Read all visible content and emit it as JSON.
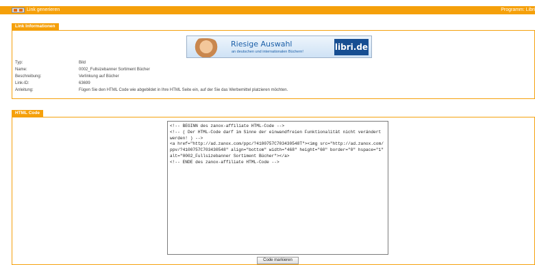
{
  "header": {
    "title": "Link  generieren",
    "program": "Programm: Libri"
  },
  "info_section": {
    "tab_label": "Link  Informationen",
    "banner": {
      "headline": "Riesige Auswahl",
      "subline": "an deutschen und internationalen Büchern!",
      "brand": "libri.de"
    },
    "rows": [
      {
        "label": "Typ:",
        "value": "Bild"
      },
      {
        "label": "Name:",
        "value": "0002_Fullsizebanner Sortiment Bücher"
      },
      {
        "label": "Beschreibung:",
        "value": "Verlinkung auf Bücher"
      },
      {
        "label": "Link-ID:",
        "value": "63699"
      },
      {
        "label": "Anleitung:",
        "value": "Fügen Sie den HTML Code wie abgebildet in Ihre HTML Seite ein, auf der Sie das Werbemittel platzieren möchten."
      }
    ]
  },
  "code_section": {
    "tab_label": "HTML Code",
    "code": "<!-- BEGINN des zanox-affiliate HTML-Code -->\n<!-- ( Der HTML-Code darf im Sinne der einwandfreien Funktionalität nicht verändert werden! ) -->\n<a href=\"http://ad.zanox.com/ppc/?4100757C703430548T\"><img src=\"http://ad.zanox.com/ppv/?4100757C703430548\" align=\"bottom\" width=\"468\" height=\"60\" border=\"0\" hspace=\"1\" alt=\"0002_Fullsizebanner Sortiment Bücher\"></a>\n<!-- ENDE des zanox-affiliate HTML-Code -->",
    "button_label": "Code markieren"
  },
  "colors": {
    "accent": "#f5a00a",
    "banner_brand": "#174e92"
  }
}
